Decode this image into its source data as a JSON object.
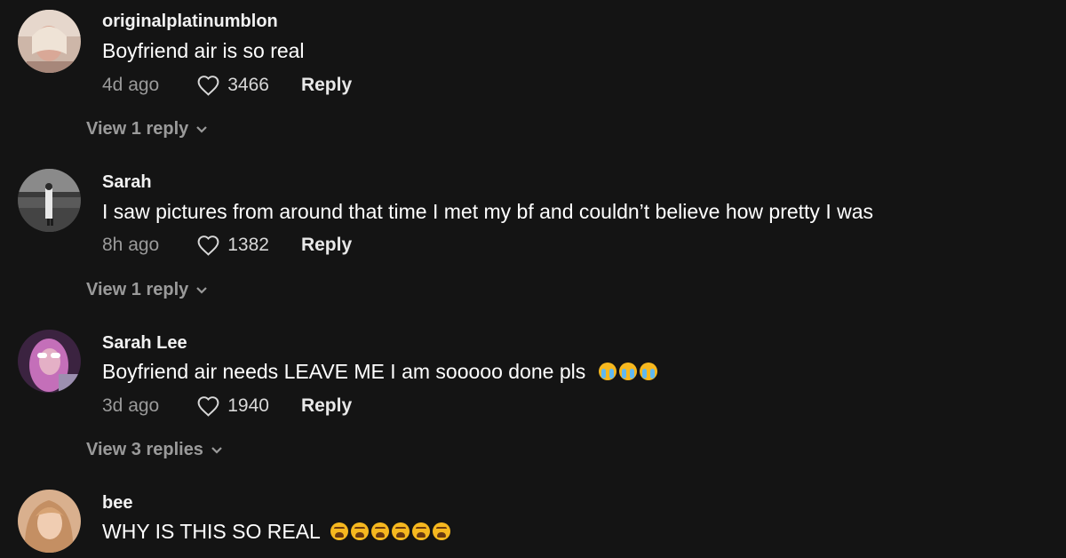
{
  "comments": [
    {
      "username": "originalplatinumblon",
      "text": "Boyfriend air is so real",
      "time": "4d ago",
      "likes": "3466",
      "reply_label": "Reply",
      "view_replies": "View 1 reply",
      "avatar_colors": [
        "#d9c2b4",
        "#b89b8c"
      ],
      "emojis": []
    },
    {
      "username": "Sarah",
      "text": "I saw pictures from around that time I met my bf and couldn’t believe how pretty I was",
      "time": "8h ago",
      "likes": "1382",
      "reply_label": "Reply",
      "view_replies": "View 1 reply",
      "avatar_colors": [
        "#7a7a7a",
        "#3d3d3d"
      ],
      "emojis": []
    },
    {
      "username": "Sarah Lee",
      "text": "Boyfriend air needs LEAVE ME I am sooooo done pls",
      "time": "3d ago",
      "likes": "1940",
      "reply_label": "Reply",
      "view_replies": "View 3 replies",
      "avatar_colors": [
        "#b46ab0",
        "#4a2a55"
      ],
      "emojis": [
        "loudly-crying-face",
        "loudly-crying-face",
        "loudly-crying-face"
      ]
    },
    {
      "username": "bee",
      "text": "WHY IS THIS SO REAL",
      "time": "",
      "likes": "",
      "reply_label": "",
      "view_replies": "",
      "avatar_colors": [
        "#e0b89a",
        "#a77a55"
      ],
      "emojis": [
        "weary-face",
        "weary-face",
        "weary-face",
        "weary-face",
        "weary-face",
        "weary-face"
      ]
    }
  ],
  "colors": {
    "background": "#141414",
    "secondary_text": "#9a9a9a",
    "primary_text": "#ffffff"
  }
}
